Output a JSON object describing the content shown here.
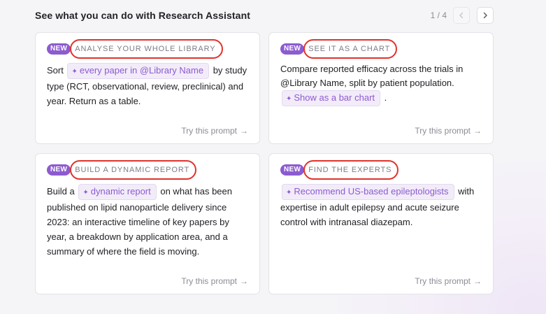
{
  "header": {
    "title": "See what you can do with Research Assistant",
    "pager": "1 / 4",
    "prev_icon": "chevron-left-icon",
    "next_icon": "chevron-right-icon"
  },
  "cards": [
    {
      "badge": "NEW",
      "label": "ANALYSE YOUR WHOLE LIBRARY",
      "before": "Sort ",
      "chip": "every paper in @Library Name",
      "after": " by study type (RCT, observational, review, preclinical) and year. Return as a table.",
      "try": "Try this prompt",
      "arrow": "→"
    },
    {
      "badge": "NEW",
      "label": "SEE IT AS A CHART",
      "before": "Compare reported efficacy across the trials in @Library Name, split by patient population. ",
      "chip": "Show as a bar chart",
      "after": " .",
      "try": "Try this prompt",
      "arrow": "→"
    },
    {
      "badge": "NEW",
      "label": "BUILD A DYNAMIC REPORT",
      "before": "Build a ",
      "chip": "dynamic report",
      "after": " on what has been published on lipid nanoparticle delivery since 2023: an interactive timeline of key papers by year, a breakdown by application area, and a summary of where the field is moving.",
      "try": "Try this prompt",
      "arrow": "→"
    },
    {
      "badge": "NEW",
      "label": "FIND THE EXPERTS",
      "before": "",
      "chip": "Recommend US-based epileptologists",
      "after": " with expertise in adult epilepsy and acute seizure control with intranasal diazepam.",
      "try": "Try this prompt",
      "arrow": "→"
    }
  ],
  "chip_icon": "sparkle-icon",
  "colors": {
    "accent": "#8d5bd0",
    "chip_bg": "#f2ecf9",
    "highlight_ring": "#e0332c",
    "muted_text": "#8b8b95"
  }
}
